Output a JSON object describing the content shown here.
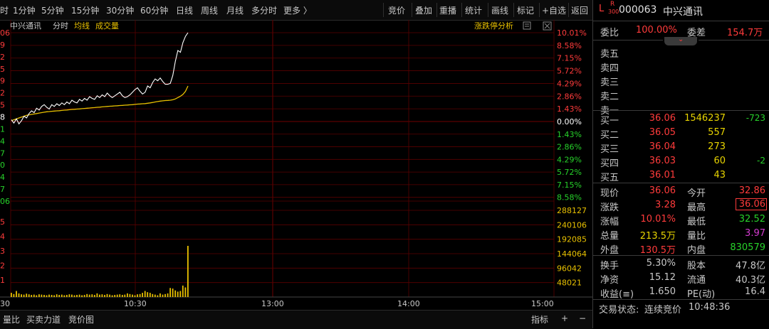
{
  "toolbar": {
    "tabs": [
      "时",
      "1分钟",
      "5分钟",
      "15分钟",
      "30分钟",
      "60分钟",
      "日线",
      "周线",
      "月线",
      "多分时",
      "更多 〉"
    ],
    "buttons": [
      "竞价",
      "叠加",
      "重播",
      "统计",
      "画线",
      "标记",
      "+自选",
      "返回"
    ]
  },
  "chart": {
    "stock_name": "中兴通讯",
    "mode_label": "分时",
    "avg_label": "均线",
    "vol_label": "成交量",
    "analysis_label": "涨跌停分析",
    "left_labels": [
      "06",
      "9",
      "2",
      "5",
      "9",
      "2",
      "5",
      "8",
      "1",
      "4",
      "7",
      "0",
      "4",
      "7",
      "06",
      "5",
      "4",
      "3",
      "2",
      "1"
    ],
    "pct_labels_up": [
      "10.01%",
      "8.58%",
      "7.15%",
      "5.72%",
      "4.29%",
      "2.86%",
      "1.43%"
    ],
    "pct_zero": "0.00%",
    "pct_labels_down": [
      "1.43%",
      "2.86%",
      "4.29%",
      "5.72%",
      "7.15%",
      "8.58%"
    ],
    "vol_labels": [
      "288127",
      "240106",
      "192085",
      "144064",
      "96042",
      "48021"
    ],
    "time_labels": [
      "30",
      "10:30",
      "13:00",
      "14:00",
      "15:00"
    ],
    "colors": {
      "up": "#ff3b3b",
      "down": "#27d22a",
      "price_line": "#ffffff",
      "avg_line": "#e8c000",
      "volume": "#e8c000",
      "grid": "#5a0000"
    }
  },
  "chart_data": {
    "type": "line",
    "series": [
      {
        "name": "",
        "values": [
          0.2,
          -0.2,
          0.3,
          -0.3,
          0.1,
          0.6,
          0.4,
          0.9,
          1.2,
          1.0,
          1.5,
          1.3,
          1.7,
          1.9,
          1.6,
          1.4,
          1.9,
          1.7,
          2.0,
          1.8,
          2.1,
          1.9,
          2.2,
          2.0,
          2.4,
          2.2,
          2.1,
          2.5,
          2.3,
          2.6,
          2.4,
          2.8,
          2.6,
          2.5,
          2.9,
          2.7,
          3.0,
          2.8,
          3.2,
          2.9,
          2.7,
          2.9,
          3.1,
          3.3,
          2.9,
          2.7,
          2.8,
          3.0,
          3.3,
          3.6,
          3.8,
          3.4,
          3.1,
          3.3,
          4.0,
          3.8,
          4.4,
          4.8,
          4.6,
          4.9,
          4.5,
          4.2,
          4.2,
          4.3,
          5.2,
          6.8,
          8.0,
          7.8,
          8.9,
          9.6,
          10.01
        ]
      },
      {
        "name": "均线",
        "values": [
          0.1,
          0.2,
          0.3,
          0.4,
          0.5,
          0.6,
          0.7,
          0.75,
          0.8,
          0.85,
          0.9,
          0.95,
          1.0,
          1.05,
          1.1,
          1.12,
          1.15,
          1.18,
          1.2,
          1.22,
          1.25,
          1.28,
          1.3,
          1.33,
          1.36,
          1.38,
          1.4,
          1.42,
          1.45,
          1.47,
          1.5,
          1.52,
          1.55,
          1.57,
          1.6,
          1.62,
          1.65,
          1.67,
          1.7,
          1.72,
          1.74,
          1.76,
          1.78,
          1.8,
          1.82,
          1.84,
          1.86,
          1.88,
          1.9,
          1.93,
          1.96,
          1.98,
          2.0,
          2.02,
          2.06,
          2.1,
          2.15,
          2.2,
          2.25,
          2.3,
          2.33,
          2.36,
          2.38,
          2.4,
          2.45,
          2.55,
          2.7,
          2.85,
          3.05,
          3.4,
          4.0
        ]
      }
    ],
    "volume": [
      14000,
      10000,
      20000,
      12000,
      9000,
      8000,
      11000,
      9000,
      7000,
      8000,
      6000,
      9000,
      8000,
      7000,
      6000,
      8000,
      7000,
      6000,
      9000,
      7000,
      8000,
      6000,
      7000,
      9000,
      8000,
      6000,
      7000,
      8000,
      6000,
      7000,
      10000,
      8000,
      9000,
      7000,
      12000,
      8000,
      9000,
      7000,
      10000,
      8000,
      6000,
      7000,
      8000,
      9000,
      7000,
      8000,
      12000,
      10000,
      8000,
      6000,
      9000,
      10000,
      14000,
      20000,
      16000,
      14000,
      10000,
      8000,
      6000,
      12000,
      8000,
      10000,
      12000,
      30000,
      28000,
      22000,
      18000,
      20000,
      38000,
      32000,
      170000
    ],
    "ylim_pct": [
      -10.01,
      10.01
    ],
    "vol_ylim": [
      0,
      288127
    ]
  },
  "bottom": {
    "tabs": [
      "量比",
      "买卖力道",
      "竞价图"
    ],
    "right_buttons": [
      "指标",
      "+",
      "−"
    ]
  },
  "panel": {
    "code": "000063",
    "name": "中兴通讯",
    "tag_l": "L",
    "tag_r": "R",
    "tag_300": "300",
    "weibi_label": "委比",
    "weibi_value": "100.00%",
    "weicha_label": "委差",
    "weicha_value": "154.7万",
    "sells": [
      "卖五",
      "卖四",
      "卖三",
      "卖二",
      "卖一"
    ],
    "buys": [
      {
        "label": "买一",
        "price": "36.06",
        "vol": "1546237",
        "chg": "-723"
      },
      {
        "label": "买二",
        "price": "36.05",
        "vol": "557",
        "chg": ""
      },
      {
        "label": "买三",
        "price": "36.04",
        "vol": "273",
        "chg": ""
      },
      {
        "label": "买四",
        "price": "36.03",
        "vol": "60",
        "chg": "-2"
      },
      {
        "label": "买五",
        "price": "36.01",
        "vol": "43",
        "chg": ""
      }
    ],
    "quote": [
      {
        "l1": "现价",
        "v1": "36.06",
        "c1": "red",
        "l2": "今开",
        "v2": "32.86",
        "c2": "red"
      },
      {
        "l1": "涨跌",
        "v1": "3.28",
        "c1": "red",
        "l2": "最高",
        "v2": "36.06",
        "c2": "red"
      },
      {
        "l1": "涨幅",
        "v1": "10.01%",
        "c1": "red",
        "l2": "最低",
        "v2": "32.52",
        "c2": "green"
      },
      {
        "l1": "总量",
        "v1": "213.5万",
        "c1": "yellow",
        "l2": "量比",
        "v2": "3.97",
        "c2": "mag"
      },
      {
        "l1": "外盘",
        "v1": "130.5万",
        "c1": "red",
        "l2": "内盘",
        "v2": "830579",
        "c2": "green"
      }
    ],
    "stats": [
      {
        "l1": "换手",
        "v1": "5.30%",
        "l2": "股本",
        "v2": "47.8亿"
      },
      {
        "l1": "净资",
        "v1": "15.12",
        "l2": "流通",
        "v2": "40.3亿"
      },
      {
        "l1": "收益(≡)",
        "v1": "1.650",
        "l2": "PE(动)",
        "v2": "16.4"
      }
    ],
    "status_label": "交易状态:",
    "status_value": "连续竞价",
    "time": "10:48:36"
  }
}
